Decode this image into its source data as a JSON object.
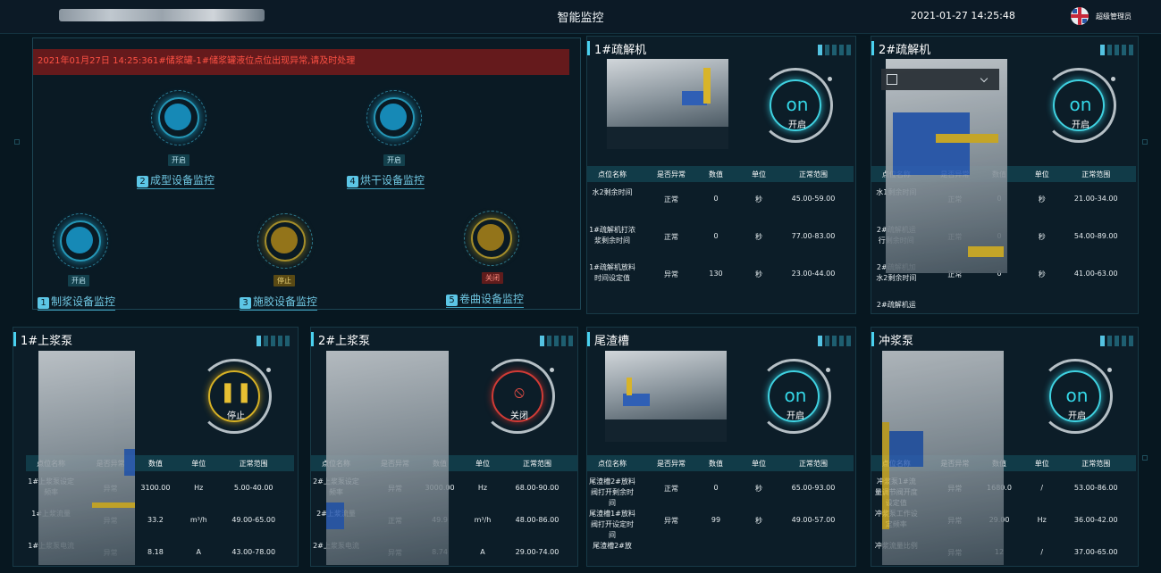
{
  "header": {
    "title": "智能监控",
    "datetime": "2021-01-27 14:25:48",
    "user": "超级管理员"
  },
  "overview": {
    "alarm": "2021年01月27日 14:25:361#储浆罐-1#储浆罐液位点位出现异常,请及时处理",
    "pads": [
      {
        "num": "2",
        "label": "成型设备监控",
        "status": "开启"
      },
      {
        "num": "4",
        "label": "烘干设备监控",
        "status": "开启"
      },
      {
        "num": "1",
        "label": "制浆设备监控",
        "status": "开启"
      },
      {
        "num": "3",
        "label": "施胶设备监控",
        "status": "停止"
      },
      {
        "num": "5",
        "label": "卷曲设备监控",
        "status": "关闭"
      }
    ]
  },
  "table_headers": [
    "点位名称",
    "是否异常",
    "数值",
    "单位",
    "正常范围"
  ],
  "panels": {
    "p1": {
      "title": "1#疏解机",
      "gauge_main": "on",
      "gauge_sub": "开启",
      "rows": [
        [
          "水2剩余时间",
          "正常",
          "0",
          "秒",
          "45.00-59.00"
        ],
        [
          "1#疏解机打浓浆剩余时间",
          "正常",
          "0",
          "秒",
          "77.00-83.00"
        ],
        [
          "1#疏解机放料时间设定值",
          "异常",
          "130",
          "秒",
          "23.00-44.00"
        ]
      ]
    },
    "p2": {
      "title": "2#疏解机",
      "gauge_main": "on",
      "gauge_sub": "开启",
      "rows": [
        [
          "水1剩余时间",
          "正常",
          "0",
          "秒",
          "21.00-34.00"
        ],
        [
          "2#疏解机运行剩余时间",
          "正常",
          "0",
          "秒",
          "54.00-89.00"
        ],
        [
          "2#疏解机加水2剩余时间",
          "正常",
          "0",
          "秒",
          "41.00-63.00"
        ],
        [
          "2#疏解机运",
          "",
          "",
          "",
          ""
        ]
      ]
    },
    "p3": {
      "title": "1#上浆泵",
      "gauge_sub": "停止",
      "rows": [
        [
          "1#上浆泵设定频率",
          "异常",
          "3100.00",
          "Hz",
          "5.00-40.00"
        ],
        [
          "1#上浆流量",
          "异常",
          "33.2",
          "m³/h",
          "49.00-65.00"
        ],
        [
          "1#上浆泵电流",
          "异常",
          "8.18",
          "A",
          "43.00-78.00"
        ]
      ]
    },
    "p4": {
      "title": "2#上浆泵",
      "gauge_sub": "关闭",
      "rows": [
        [
          "2#上浆泵设定频率",
          "异常",
          "3000.00",
          "Hz",
          "68.00-90.00"
        ],
        [
          "2#上浆流量",
          "正常",
          "49.9",
          "m³/h",
          "48.00-86.00"
        ],
        [
          "2#上浆泵电流",
          "异常",
          "8.74",
          "A",
          "29.00-74.00"
        ]
      ]
    },
    "p5": {
      "title": "尾渣槽",
      "gauge_main": "on",
      "gauge_sub": "开启",
      "rows": [
        [
          "尾渣槽2#放料阀打开剩余时间",
          "正常",
          "0",
          "秒",
          "65.00-93.00"
        ],
        [
          "尾渣槽1#放料阀打开设定时间",
          "异常",
          "99",
          "秒",
          "49.00-57.00"
        ],
        [
          "尾渣槽2#放",
          "",
          "",
          "",
          ""
        ]
      ]
    },
    "p6": {
      "title": "冲浆泵",
      "gauge_main": "on",
      "gauge_sub": "开启",
      "rows": [
        [
          "冲浆泵1#流量调节阀开度设定值",
          "异常",
          "1680.0",
          "/",
          "53.00-86.00"
        ],
        [
          "冲浆泵工作设定频率",
          "异常",
          "29.00",
          "Hz",
          "36.00-42.00"
        ],
        [
          "冲浆流量比例",
          "异常",
          "12",
          "/",
          "37.00-65.00"
        ]
      ]
    }
  },
  "colors": {
    "accent": "#4ad1ef",
    "on": "#34d7e7",
    "pause": "#e7c032",
    "stop": "#e04b44",
    "alarm_bg": "#651a1c"
  }
}
